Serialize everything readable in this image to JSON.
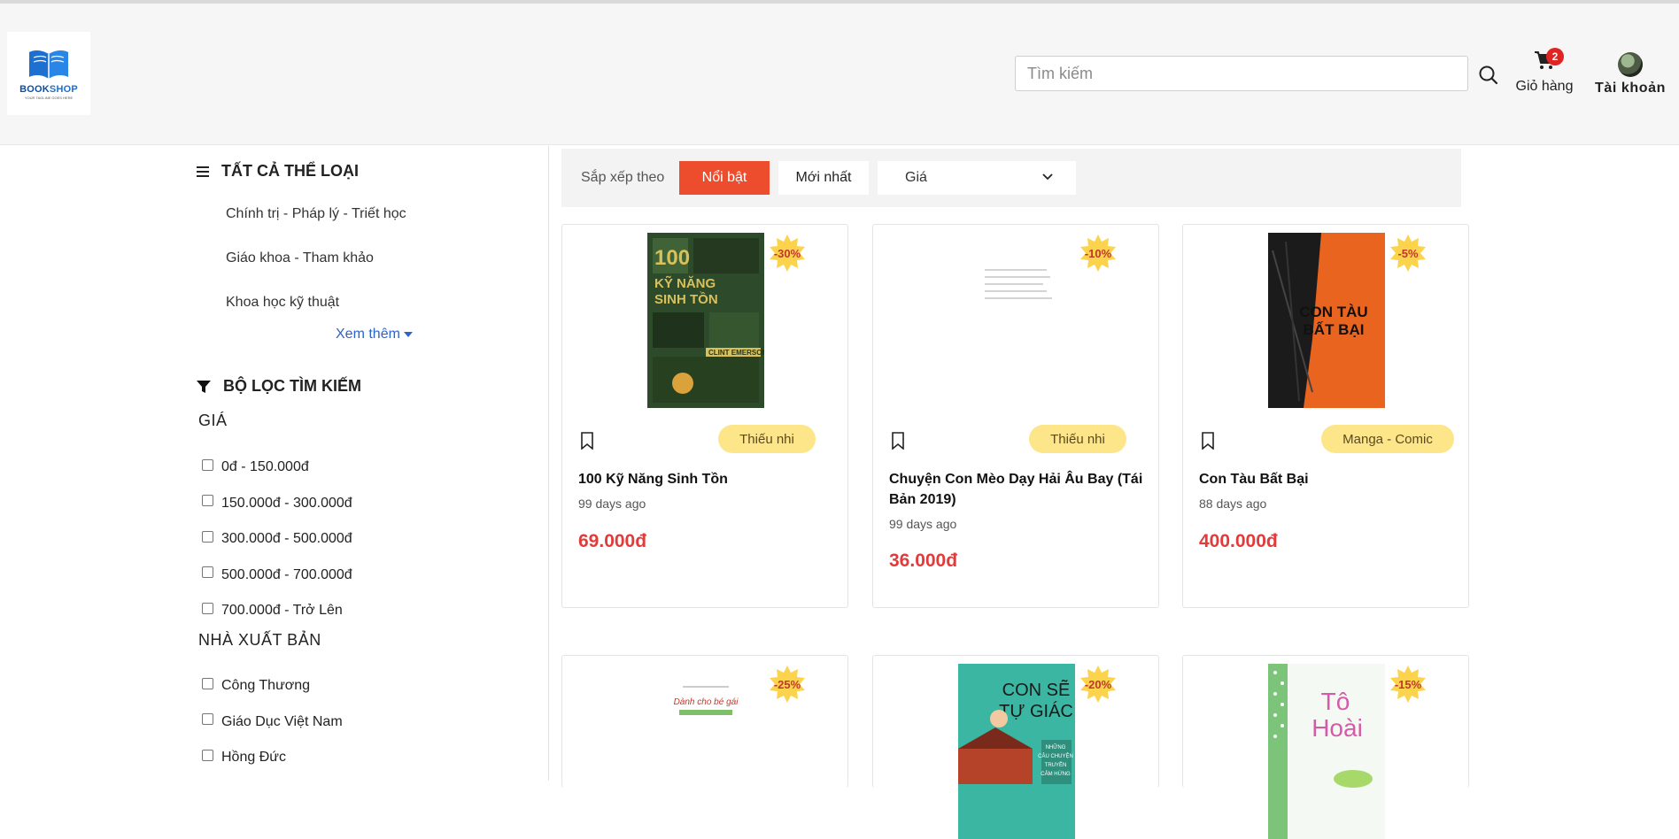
{
  "header": {
    "logo_word_a": "BOOK",
    "logo_word_b": "SHOP",
    "logo_tagline": "YOUR TAGLINE GOES HERE",
    "search_placeholder": "Tìm kiếm",
    "cart_label": "Giỏ hàng",
    "cart_count": "2",
    "account_label": "Tài khoản"
  },
  "sidebar": {
    "categories_title": "TẤT CẢ THỂ LOẠI",
    "categories": [
      "Chính trị - Pháp lý - Triết học",
      "Giáo khoa - Tham khảo",
      "Khoa học kỹ thuật"
    ],
    "see_more": "Xem thêm",
    "filter_title": "BỘ LỌC TÌM KIẾM",
    "price_group": "GIÁ",
    "price_options": [
      "0đ - 150.000đ",
      "150.000đ - 300.000đ",
      "300.000đ - 500.000đ",
      "500.000đ - 700.000đ",
      "700.000đ - Trở Lên"
    ],
    "publisher_group": "NHÀ XUẤT BẢN",
    "publisher_options": [
      "Công Thương",
      "Giáo Dục Việt Nam",
      "Hồng Đức"
    ]
  },
  "sort": {
    "label": "Sắp xếp theo",
    "featured": "Nổi bật",
    "newest": "Mới nhất",
    "price": "Giá"
  },
  "products": [
    {
      "title": "100 Kỹ Năng Sinh Tồn",
      "date": "99 days ago",
      "price": "69.000đ",
      "discount": "-30%",
      "category": "Thiếu nhi",
      "cover_lines": [
        "100",
        "KỸ NĂNG",
        "SINH TỒN",
        "CLINT EMERSON"
      ]
    },
    {
      "title": "Chuyện Con Mèo Dạy Hải Âu Bay (Tái Bản 2019)",
      "date": "99 days ago",
      "price": "36.000đ",
      "discount": "-10%",
      "category": "Thiếu nhi"
    },
    {
      "title": "Con Tàu Bất Bại",
      "date": "88 days ago",
      "price": "400.000đ",
      "discount": "-5%",
      "category": "Manga - Comic",
      "cover_lines": [
        "CON TÀU",
        "BẤT BẠI"
      ]
    },
    {
      "discount": "-25%",
      "cover_lines": [
        "Dành cho bé gái"
      ]
    },
    {
      "discount": "-20%",
      "cover_lines": [
        "CON SẼ",
        "TỰ GIÁC",
        "NHỮNG",
        "CÂU CHUYỆN",
        "TRUYỀN",
        "CẢM HỨNG"
      ]
    },
    {
      "discount": "-15%",
      "cover_lines": [
        "Tô",
        "Hoài"
      ]
    }
  ],
  "colors": {
    "accent": "#ee4d2d",
    "price": "#e23b3b",
    "tag": "#fde68a",
    "link": "#2b63c8",
    "badge": "#e02424"
  }
}
